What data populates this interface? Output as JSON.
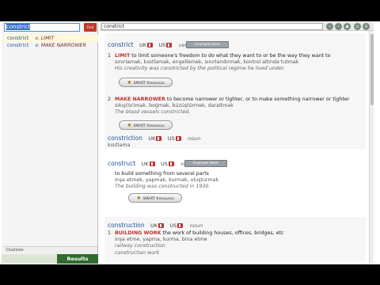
{
  "search": {
    "value": "constrict",
    "find_label": "Find"
  },
  "results": [
    {
      "headword": "constrict",
      "pos": "v.",
      "gloss": "LIMIT"
    },
    {
      "headword": "constrict",
      "pos": "v.",
      "gloss": "MAKE NARROWER"
    }
  ],
  "status_text": "Dualizee",
  "results_tab": "Results",
  "word_field": "constrict",
  "regions": {
    "uk": "UK",
    "us": "US"
  },
  "buttons": {
    "example_bank": "Example bank",
    "smart": "SMART thesaurus"
  },
  "entries": {
    "constrict_verb": {
      "headword": "constrict",
      "pos": "verb",
      "senses": [
        {
          "num": "1",
          "guide": "LIMIT",
          "definition": "to limit someone's freedom to do what they want to or be the way they want to",
          "translation": "sınırlamak, kısıtlamak, engellemek, sınırlandırmak, kontrol altında tutmak",
          "example": "His creativity was constricted by the political regime he lived under."
        },
        {
          "num": "2",
          "guide": "MAKE NARROWER",
          "definition": "to become narrower or tighter, or to make something narrower or tighter",
          "translation": "sıkış(tır)mak, boğmak, büzüştürmek, daraltmak",
          "example": "The blood vessels constricted."
        }
      ]
    },
    "constriction_noun": {
      "headword": "constriction",
      "pos": "noun",
      "translation": "kısıtlama"
    },
    "construct_verb": {
      "headword": "construct",
      "pos": "verb",
      "definition": "to build something from several parts",
      "translation": "inşa etmek, yapmak, kurmak, oluşturmak",
      "example": "The building was constructed in 1930."
    },
    "construction_noun": {
      "headword": "construction",
      "pos": "noun",
      "sense": {
        "num": "1",
        "guide": "BUILDING WORK",
        "definition": "the work of building houses, offices, bridges, etc",
        "translation": "inşa etme, yapma, kurma, bina etme",
        "examples": [
          "railway construction",
          "construction work"
        ]
      }
    }
  }
}
